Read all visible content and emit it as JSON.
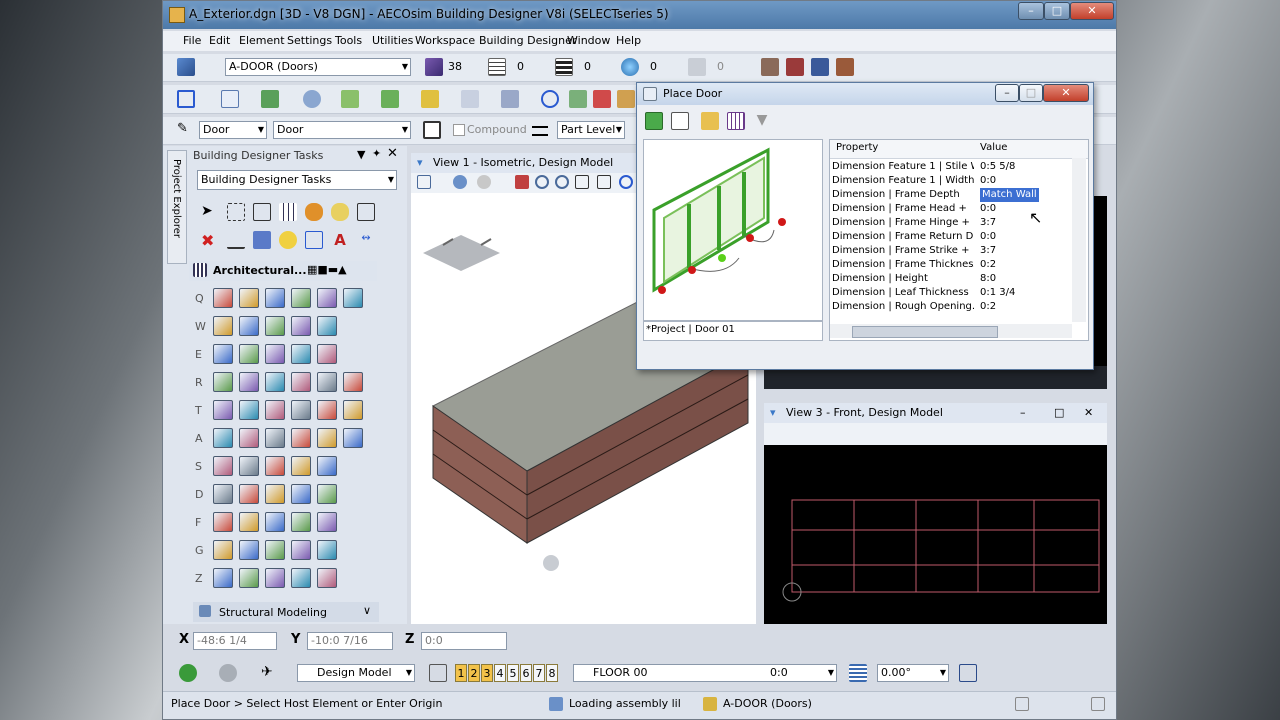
{
  "window": {
    "title": "A_Exterior.dgn [3D - V8 DGN] - AECOsim Building Designer V8i (SELECTseries 5)"
  },
  "menu": [
    "File",
    "Edit",
    "Element",
    "Settings",
    "Tools",
    "Utilities",
    "Workspace",
    "Building Designer",
    "Window",
    "Help"
  ],
  "toolbar1": {
    "level": "A-DOOR (Doors)",
    "color": "38",
    "style": "0",
    "weight": "0",
    "transparency": "0",
    "priority": "0"
  },
  "toolbar3": {
    "family": "Door",
    "part": "Door",
    "compound": "Compound",
    "level_mode": "Part Level"
  },
  "tasks": {
    "header": "Building Designer Tasks",
    "combo": "Building Designer Tasks",
    "section": "Architectural...",
    "footer": "Structural Modeling",
    "side_tab": "Project Explorer",
    "rows": [
      "Q",
      "W",
      "E",
      "R",
      "T",
      "A",
      "S",
      "D",
      "F",
      "G",
      "Z"
    ]
  },
  "view1": {
    "title": "View 1 - Isometric, Design Model"
  },
  "view3": {
    "title": "View 3 - Front, Design Model"
  },
  "dialog": {
    "title": "Place Door",
    "col_property": "Property",
    "col_value": "Value",
    "footer_label": "*Project | Door 01",
    "rows": [
      {
        "p": "Dimension Feature 1 | Stile W...",
        "v": "0:5 5/8"
      },
      {
        "p": "Dimension Feature 1 | Width",
        "v": "0:0"
      },
      {
        "p": "Dimension | Frame Depth",
        "v": "Match Wall"
      },
      {
        "p": "Dimension | Frame Head +",
        "v": "0:0"
      },
      {
        "p": "Dimension | Frame Hinge +",
        "v": "3:7"
      },
      {
        "p": "Dimension | Frame Return D...",
        "v": "0:0"
      },
      {
        "p": "Dimension | Frame Strike +",
        "v": "3:7"
      },
      {
        "p": "Dimension | Frame Thickness",
        "v": "0:2"
      },
      {
        "p": "Dimension | Height",
        "v": "8:0"
      },
      {
        "p": "Dimension | Leaf Thickness",
        "v": "0:1 3/4"
      },
      {
        "p": "Dimension | Rough Opening...",
        "v": "0:2"
      }
    ]
  },
  "coords": {
    "x_label": "X",
    "x": "-48:6 1/4",
    "y_label": "Y",
    "y": "-10:0 7/16",
    "z_label": "Z",
    "z": "0:0"
  },
  "bottombar": {
    "model": "Design Model",
    "views": [
      "1",
      "2",
      "3",
      "4",
      "5",
      "6",
      "7",
      "8"
    ],
    "floor": "FLOOR 00",
    "floor_val": "0:0",
    "angle": "0.00°"
  },
  "status": {
    "prompt": "Place Door > Select Host Element or Enter Origin",
    "message": "Loading assembly lil",
    "level": "A-DOOR (Doors)"
  },
  "colors": {
    "accent": "#3a78c8",
    "roof": "#9a9d95",
    "wall": "#8d5f55",
    "highlight": "#3c6fd2"
  }
}
